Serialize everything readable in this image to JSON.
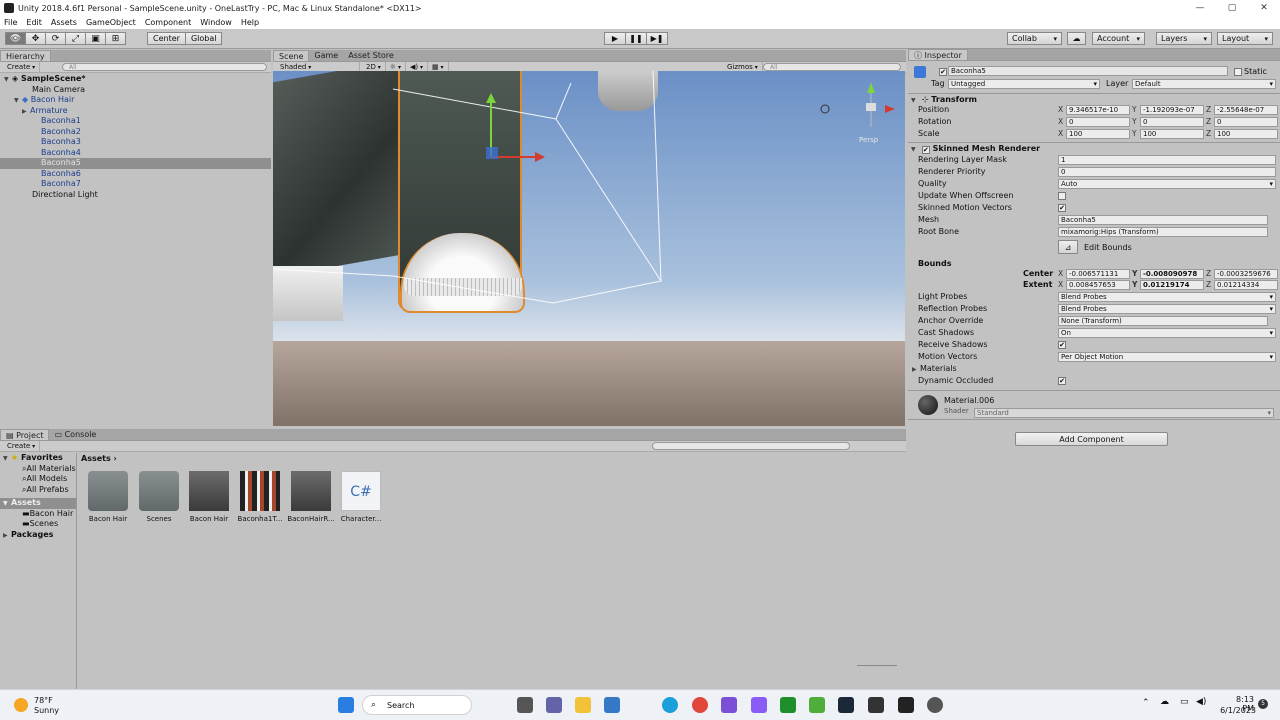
{
  "window": {
    "title": "Unity 2018.4.6f1 Personal - SampleScene.unity - OneLastTry - PC, Mac & Linux Standalone* <DX11>",
    "minimize": "—",
    "maximize": "▢",
    "close": "✕"
  },
  "menu": [
    "File",
    "Edit",
    "Assets",
    "GameObject",
    "Component",
    "Window",
    "Help"
  ],
  "toolbar": {
    "center": "Center",
    "global": "Global",
    "collab": "Collab",
    "account": "Account",
    "layers": "Layers",
    "layout": "Layout"
  },
  "hierarchy": {
    "tab": "Hierarchy",
    "create": "Create",
    "search_placeholder": "All",
    "items": [
      {
        "label": "SampleScene*"
      },
      {
        "label": "Main Camera"
      },
      {
        "label": "Bacon Hair"
      },
      {
        "label": "Armature"
      },
      {
        "label": "Baconha1"
      },
      {
        "label": "Baconha2"
      },
      {
        "label": "Baconha3"
      },
      {
        "label": "Baconha4"
      },
      {
        "label": "Baconha5"
      },
      {
        "label": "Baconha6"
      },
      {
        "label": "Baconha7"
      },
      {
        "label": "Directional Light"
      }
    ]
  },
  "scene": {
    "tabs": [
      "Scene",
      "Game",
      "Asset Store"
    ],
    "shading": "Shaded",
    "mode2d": "2D",
    "gizmos": "Gizmos",
    "search_placeholder": "All",
    "persp": "Persp"
  },
  "inspector": {
    "tab": "Inspector",
    "object_name": "Baconha5",
    "static_label": "Static",
    "tag_label": "Tag",
    "tag_value": "Untagged",
    "layer_label": "Layer",
    "layer_value": "Default",
    "transform": {
      "header": "Transform",
      "position_label": "Position",
      "rotation_label": "Rotation",
      "scale_label": "Scale",
      "position": [
        "9.346517e-10",
        "-1.192093e-07",
        "-2.55648e-07"
      ],
      "rotation": [
        "0",
        "0",
        "0"
      ],
      "scale": [
        "100",
        "100",
        "100"
      ]
    },
    "smr": {
      "header": "Skinned Mesh Renderer",
      "rendering_layer_mask": "Rendering Layer Mask",
      "rendering_layer_mask_value": "1",
      "renderer_priority": "Renderer Priority",
      "renderer_priority_value": "0",
      "quality": "Quality",
      "quality_value": "Auto",
      "update_offscreen": "Update When Offscreen",
      "skinned_motion": "Skinned Motion Vectors",
      "mesh": "Mesh",
      "mesh_value": "Baconha5",
      "root_bone": "Root Bone",
      "root_bone_value": "mixamorig:Hips (Transform)",
      "edit_bounds": "Edit Bounds",
      "bounds": "Bounds",
      "center": "Center",
      "extent": "Extent",
      "center_values": [
        "-0.006571131",
        "-0.008090978",
        "-0.0003259676"
      ],
      "extent_values": [
        "0.008457653",
        "0.01219174",
        "0.01214334"
      ],
      "light_probes": "Light Probes",
      "light_probes_value": "Blend Probes",
      "reflection_probes": "Reflection Probes",
      "reflection_probes_value": "Blend Probes",
      "anchor_override": "Anchor Override",
      "anchor_override_value": "None (Transform)",
      "cast_shadows": "Cast Shadows",
      "cast_shadows_value": "On",
      "receive_shadows": "Receive Shadows",
      "motion_vectors": "Motion Vectors",
      "motion_vectors_value": "Per Object Motion",
      "materials": "Materials",
      "dynamic_occluded": "Dynamic Occluded"
    },
    "material": {
      "name": "Material.006",
      "shader_label": "Shader",
      "shader_value": "Standard"
    },
    "add_component": "Add Component"
  },
  "project": {
    "tabs": [
      "Project",
      "Console"
    ],
    "create": "Create",
    "breadcrumb": "Assets",
    "favorites": "Favorites",
    "fav_items": [
      "All Materials",
      "All Models",
      "All Prefabs"
    ],
    "assets": "Assets",
    "asset_children": [
      "Bacon Hair",
      "Scenes"
    ],
    "packages": "Packages",
    "items": [
      "Bacon Hair",
      "Scenes",
      "Bacon Hair",
      "Baconha1T...",
      "BaconHairR...",
      "Character..."
    ],
    "csharp": "C#"
  },
  "taskbar": {
    "weather_temp": "78°F",
    "weather_desc": "Sunny",
    "search": "Search",
    "time": "8:13 PM",
    "date": "6/1/2023",
    "notif": "5"
  }
}
